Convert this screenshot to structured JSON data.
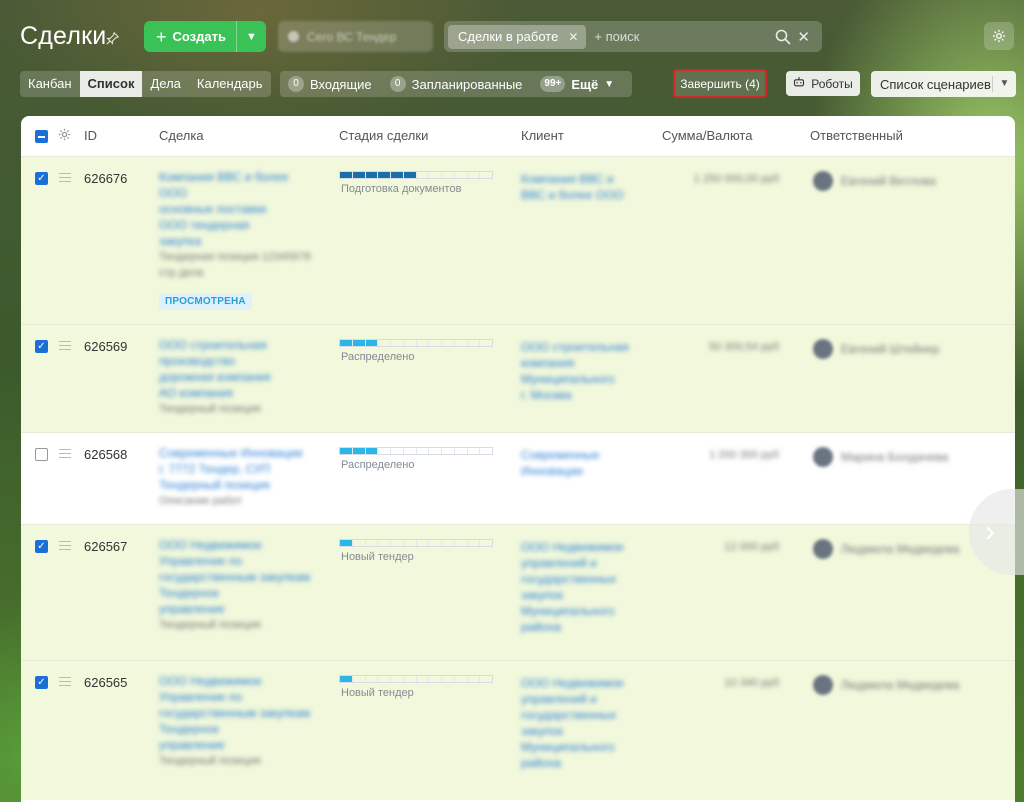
{
  "header": {
    "title": "Сделки",
    "create_label": "Создать",
    "blurred_chip_label": "Сего ВС Тендер",
    "filter_tag": "Сделки в работе",
    "search_placeholder": "+ поиск"
  },
  "toolbar": {
    "views": [
      "Канбан",
      "Список",
      "Дела",
      "Календарь"
    ],
    "active_view": "Список",
    "counters": [
      {
        "count": "0",
        "label": "Входящие"
      },
      {
        "count": "0",
        "label": "Запланированные"
      }
    ],
    "more_count": "99+",
    "more_label": "Ещё",
    "finish_label": "Завершить (4)",
    "robots_label": "Роботы",
    "scenarios_label": "Список сценариев"
  },
  "grid": {
    "columns": {
      "id": "ID",
      "deal": "Сделка",
      "stage": "Стадия сделки",
      "client": "Клиент",
      "sum": "Сумма/Валюта",
      "responsible": "Ответственный"
    },
    "rows": [
      {
        "id": "626676",
        "selected": true,
        "stage": "Подготовка документов",
        "stage_progress": 0.5,
        "stage_color": "#1a6fa8",
        "deal_lines": [
          "Компания ВВС и более ООО",
          "основные поставки",
          "ООО тендерная",
          "закупка",
          "Тендерная позиция 12345678 стр дела"
        ],
        "client_lines": [
          "Компания ВВС и",
          "ВВС и более ООО"
        ],
        "sum": "1 250 000,00 руб",
        "responsible": "Евгений Ветлова",
        "badge": "ПРОСМОТРЕНА"
      },
      {
        "id": "626569",
        "selected": true,
        "stage": "Распределено",
        "stage_progress": 0.25,
        "stage_color": "#2cb6e8",
        "deal_lines": [
          "ООО строительная",
          "производство",
          "дорожная компания",
          "АО компания",
          "Тендерный позиция"
        ],
        "client_lines": [
          "ООО строительная",
          "компания",
          "Муниципального",
          "г. Москва"
        ],
        "sum": "50 300,54 руб",
        "responsible": "Евгений Штейнер",
        "badge": ""
      },
      {
        "id": "626568",
        "selected": false,
        "stage": "Распределено",
        "stage_progress": 0.25,
        "stage_color": "#2cb6e8",
        "deal_lines": [
          "Современные Инновации",
          "г. 7772 Тендер, СУП",
          "Тендерный позиция",
          "Описание работ"
        ],
        "client_lines": [
          "Современные",
          "Инновации"
        ],
        "sum": "1 200 300 руб",
        "responsible": "Марина Болдачева",
        "badge": ""
      },
      {
        "id": "626567",
        "selected": true,
        "stage": "Новый тендер",
        "stage_progress": 0.08,
        "stage_color": "#2cb6e8",
        "deal_lines": [
          "ООО Недвижимое",
          "Управление по",
          "государственным закупкам",
          "Тендерное",
          "управление",
          "Тендерный позиция"
        ],
        "client_lines": [
          "ООО Недвижимое",
          "управлений и",
          "государственных",
          "закупок",
          "Муниципального",
          "района"
        ],
        "sum": "12 000 руб",
        "responsible": "Людмила Медведева",
        "badge": ""
      },
      {
        "id": "626565",
        "selected": true,
        "stage": "Новый тендер",
        "stage_progress": 0.08,
        "stage_color": "#2cb6e8",
        "deal_lines": [
          "ООО Недвижимое",
          "Управление по",
          "государственным закупкам",
          "Тендерное",
          "управление",
          "Тендерный позиция"
        ],
        "client_lines": [
          "ООО Недвижимое",
          "управлений и",
          "государственных",
          "закупок",
          "Муниципального",
          "района"
        ],
        "sum": "10 340 руб",
        "responsible": "Людмила Медведева",
        "badge": ""
      }
    ]
  }
}
